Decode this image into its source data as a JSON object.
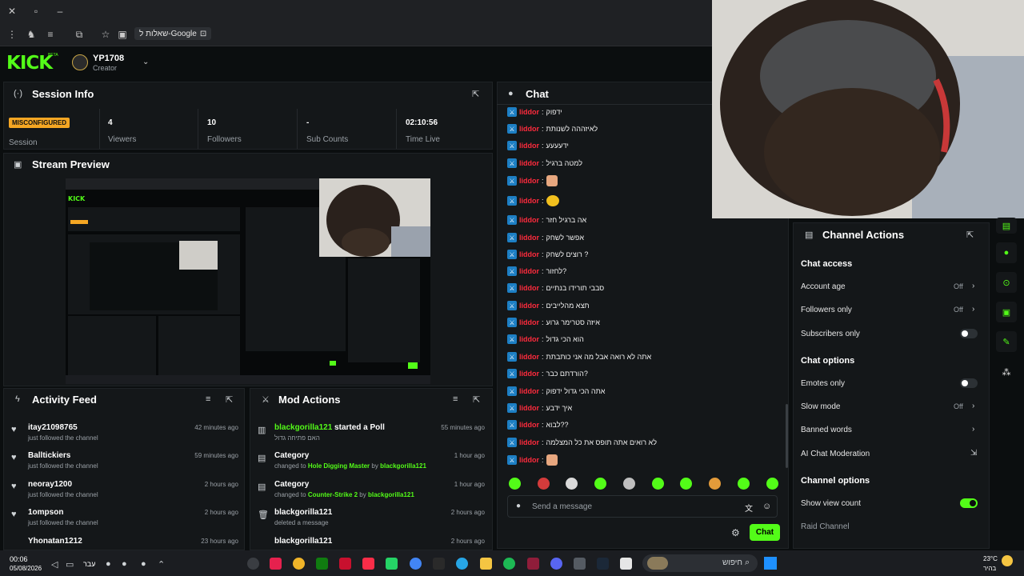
{
  "browser": {
    "google_chip": "שאלות ל-Google"
  },
  "header": {
    "logo": "KICK",
    "logo_badge": "BETA",
    "channel_name": "YP1708",
    "channel_role": "Creator"
  },
  "session_info": {
    "title": "Session Info",
    "badge": "MISCONFIGURED",
    "badge_label": "Session",
    "stats": [
      {
        "value": "4",
        "label": "Viewers"
      },
      {
        "value": "10",
        "label": "Followers"
      },
      {
        "value": "-",
        "label": "Sub Counts"
      },
      {
        "value": "02:10:56",
        "label": "Time Live"
      }
    ]
  },
  "stream_preview": {
    "title": "Stream Preview"
  },
  "activity_feed": {
    "title": "Activity Feed",
    "items": [
      {
        "name": "itay21098765",
        "sub": "just followed the channel",
        "time": "42 minutes ago"
      },
      {
        "name": "Balltickiers",
        "sub": "just followed the channel",
        "time": "59 minutes ago"
      },
      {
        "name": "neoray1200",
        "sub": "just followed the channel",
        "time": "2 hours ago"
      },
      {
        "name": "1ompson",
        "sub": "just followed the channel",
        "time": "2 hours ago"
      },
      {
        "name": "Yhonatan1212",
        "sub": "",
        "time": "23 hours ago"
      }
    ]
  },
  "mod_actions": {
    "title": "Mod Actions",
    "items": [
      {
        "user": "blackgorilla121",
        "action": "started a Poll",
        "sub": "האם פתיחה גדול",
        "time": "55 minutes ago"
      },
      {
        "title": "Category",
        "pre": "changed to",
        "target": "Hole Digging Master",
        "by": "by",
        "byuser": "blackgorilla121",
        "time": "1 hour ago"
      },
      {
        "title": "Category",
        "pre": "changed to",
        "target": "Counter-Strike 2",
        "by": "by",
        "byuser": "blackgorilla121",
        "time": "1 hour ago"
      },
      {
        "title": "blackgorilla121",
        "sub": "deleted a message",
        "time": "2 hours ago"
      },
      {
        "title": "blackgorilla121",
        "sub": "",
        "time": "2 hours ago"
      }
    ]
  },
  "chat": {
    "title": "Chat",
    "messages": [
      {
        "user": "liddor",
        "text": "ידפוק"
      },
      {
        "user": "liddor",
        "text": "לאיזההה לשנותת"
      },
      {
        "user": "liddor",
        "text": "ידעעעע"
      },
      {
        "user": "liddor",
        "text": "למטה ברגיל"
      },
      {
        "user": "liddor",
        "text": ""
      },
      {
        "user": "liddor",
        "text": ""
      },
      {
        "user": "liddor",
        "text": "אה ברגיל חזר"
      },
      {
        "user": "liddor",
        "text": "אפשר לשחק"
      },
      {
        "user": "liddor",
        "text": "רוצים לשחק ?"
      },
      {
        "user": "liddor",
        "text": "לחזור?"
      },
      {
        "user": "liddor",
        "text": "סבבי תורידו בנתיים"
      },
      {
        "user": "liddor",
        "text": "תצא מהלייבים"
      },
      {
        "user": "liddor",
        "text": "איזה סטרימר גרוע"
      },
      {
        "user": "liddor",
        "text": "הוא הכי גדול"
      },
      {
        "user": "liddor",
        "text": "אתה לא רואה אבל מה אני כותבתת"
      },
      {
        "user": "liddor",
        "text": "הורדתם כבר?"
      },
      {
        "user": "liddor",
        "text": "אתה הכי גדול ידפוק"
      },
      {
        "user": "liddor",
        "text": "איך ידבע"
      },
      {
        "user": "liddor",
        "text": "לבוא??"
      },
      {
        "user": "liddor",
        "text": "לא רואים אתה תופס את כל המצלמה"
      },
      {
        "user": "liddor",
        "text": ""
      }
    ],
    "input_placeholder": "Send a message",
    "send_label": "Chat"
  },
  "channel_actions": {
    "title": "Channel Actions",
    "chat_access": "Chat access",
    "account_age": "Account age",
    "account_age_value": "Off",
    "followers_only": "Followers only",
    "followers_only_value": "Off",
    "subscribers_only": "Subscribers only",
    "chat_options": "Chat options",
    "emotes_only": "Emotes only",
    "slow_mode": "Slow mode",
    "slow_mode_value": "Off",
    "banned_words": "Banned words",
    "ai_moderation": "AI Chat Moderation",
    "channel_options": "Channel options",
    "show_view_count": "Show view count",
    "raid_channel": "Raid Channel"
  },
  "taskbar": {
    "time": "00:06",
    "date": "05/08/2026",
    "lang": "עבר",
    "search": "חיפוש",
    "weather_temp": "23°C",
    "weather_desc": "בהיר"
  }
}
